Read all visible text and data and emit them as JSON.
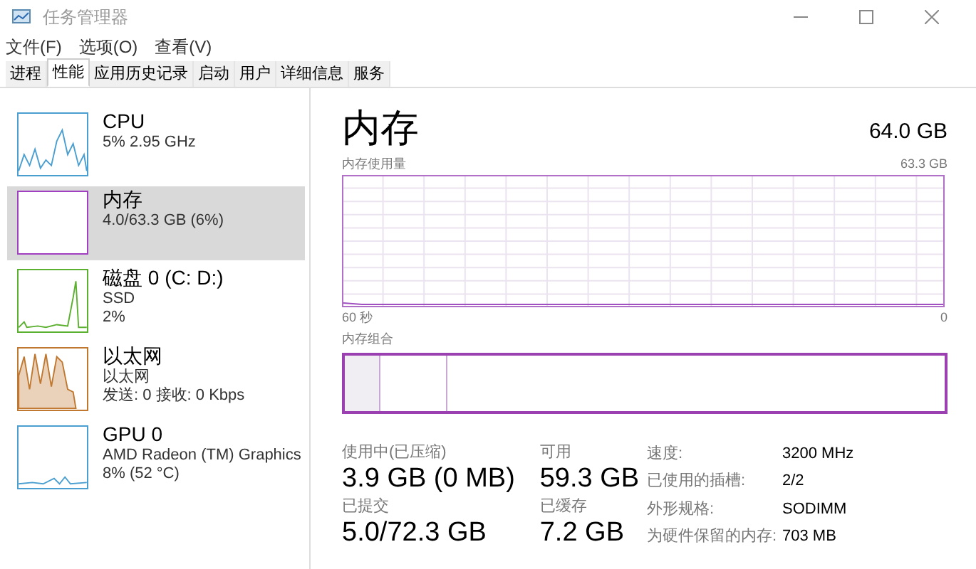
{
  "window": {
    "title": "任务管理器"
  },
  "menu": [
    "文件(F)",
    "选项(O)",
    "查看(V)"
  ],
  "tabs": [
    {
      "label": "进程",
      "selected": false
    },
    {
      "label": "性能",
      "selected": true
    },
    {
      "label": "应用历史记录",
      "selected": false
    },
    {
      "label": "启动",
      "selected": false
    },
    {
      "label": "用户",
      "selected": false
    },
    {
      "label": "详细信息",
      "selected": false
    },
    {
      "label": "服务",
      "selected": false
    }
  ],
  "sidebar": {
    "items": [
      {
        "name": "CPU",
        "lines": [
          "5% 2.95 GHz"
        ],
        "color": "#4a9fd0",
        "selected": false
      },
      {
        "name": "内存",
        "lines": [
          "4.0/63.3 GB (6%)"
        ],
        "color": "#a040c0",
        "selected": true
      },
      {
        "name": "磁盘 0 (C: D:)",
        "lines": [
          "SSD",
          "2%"
        ],
        "color": "#5cb030",
        "selected": false
      },
      {
        "name": "以太网",
        "lines": [
          "以太网",
          "发送: 0 接收: 0 Kbps"
        ],
        "color": "#c07830",
        "selected": false
      },
      {
        "name": "GPU 0",
        "lines": [
          "AMD Radeon (TM) Graphics",
          "8% (52 °C)"
        ],
        "color": "#4a9fd0",
        "selected": false
      }
    ]
  },
  "detail": {
    "title": "内存",
    "capacity": "64.0 GB",
    "usage_label": "内存使用量",
    "usage_max": "63.3 GB",
    "time_start": "60 秒",
    "time_end": "0",
    "composition_label": "内存组合",
    "composition": [
      {
        "level": 0.06,
        "shaded": true
      },
      {
        "level": 0.11,
        "shaded": false
      },
      {
        "level": 0.83,
        "shaded": false
      }
    ],
    "stats": [
      {
        "label": "使用中(已压缩)",
        "value": "3.9 GB (0 MB)"
      },
      {
        "label": "可用",
        "value": "59.3 GB"
      },
      {
        "label": "已提交",
        "value": "5.0/72.3 GB"
      },
      {
        "label": "已缓存",
        "value": "7.2 GB"
      }
    ],
    "properties": [
      {
        "key": "速度:",
        "value": "3200 MHz"
      },
      {
        "key": "已使用的插槽:",
        "value": "2/2"
      },
      {
        "key": "外形规格:",
        "value": "SODIMM"
      },
      {
        "key": "为硬件保留的内存:",
        "value": "703 MB"
      }
    ]
  }
}
